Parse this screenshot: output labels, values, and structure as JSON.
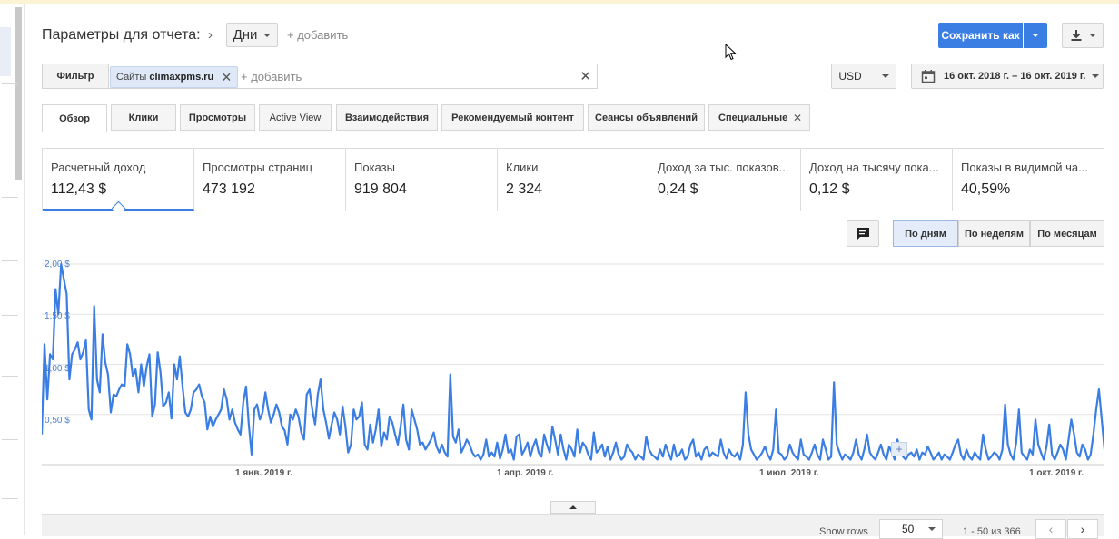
{
  "header": {
    "title": "Параметры для отчета:",
    "dimension": "Дни",
    "add_link": "+ добавить",
    "save_label": "Сохранить как"
  },
  "filter": {
    "label": "Фильтр",
    "chip_prefix": "Сайты",
    "chip_value": "climaxpms.ru",
    "add_link": "+ добавить"
  },
  "currency": "USD",
  "date_range": "16 окт. 2018 г. – 16 окт. 2019 г.",
  "tabs": [
    "Обзор",
    "Клики",
    "Просмотры",
    "Active View",
    "Взаимодействия",
    "Рекомендуемый контент",
    "Сеансы объявлений",
    "Специальные"
  ],
  "metrics": [
    {
      "label": "Расчетный доход",
      "value": "112,43 $"
    },
    {
      "label": "Просмотры страниц",
      "value": "473 192"
    },
    {
      "label": "Показы",
      "value": "919 804"
    },
    {
      "label": "Клики",
      "value": "2 324"
    },
    {
      "label": "Доход за тыс. показов...",
      "value": "0,24 $"
    },
    {
      "label": "Доход на тысячу пока...",
      "value": "0,12 $"
    },
    {
      "label": "Показы в видимой ча...",
      "value": "40,59%"
    }
  ],
  "granularity": [
    "По дням",
    "По неделям",
    "По месяцам"
  ],
  "chart_data": {
    "type": "line",
    "series": [
      {
        "values": [
          0.3,
          1.2,
          0.65,
          1.1,
          1.05,
          1.75,
          1.5,
          2.0,
          1.85,
          1.7,
          0.85,
          1.1,
          1.15,
          1.22,
          1.05,
          1.12,
          1.24,
          0.55,
          0.45,
          1.58,
          0.85,
          0.72,
          1.3,
          1.02,
          0.9,
          0.52,
          0.7,
          0.68,
          0.75,
          0.8,
          0.78,
          1.2,
          1.1,
          0.88,
          0.95,
          0.72,
          1.0,
          0.78,
          0.98,
          1.1,
          0.48,
          0.6,
          1.12,
          0.92,
          0.58,
          0.62,
          0.72,
          0.46,
          1.0,
          0.85,
          1.08,
          0.78,
          0.52,
          0.48,
          0.55,
          0.72,
          0.75,
          0.8,
          0.68,
          0.62,
          0.35,
          0.48,
          0.38,
          0.45,
          0.5,
          0.55,
          0.75,
          0.65,
          0.45,
          0.55,
          0.42,
          0.35,
          0.3,
          0.62,
          0.78,
          0.4,
          0.1,
          0.55,
          0.6,
          0.45,
          0.52,
          0.72,
          0.55,
          0.42,
          0.5,
          0.6,
          0.52,
          0.38,
          0.34,
          0.2,
          0.5,
          0.45,
          0.55,
          0.48,
          0.32,
          0.25,
          0.7,
          0.75,
          0.55,
          0.4,
          0.7,
          0.85,
          0.55,
          0.42,
          0.26,
          0.4,
          0.52,
          0.45,
          0.3,
          0.58,
          0.38,
          0.12,
          0.2,
          0.55,
          0.45,
          0.48,
          0.62,
          0.2,
          0.15,
          0.4,
          0.22,
          0.35,
          0.55,
          0.18,
          0.32,
          0.25,
          0.48,
          0.42,
          0.3,
          0.2,
          0.38,
          0.6,
          0.25,
          0.15,
          0.55,
          0.45,
          0.35,
          0.2,
          0.22,
          0.15,
          0.2,
          0.25,
          0.32,
          0.18,
          0.12,
          0.2,
          0.12,
          0.08,
          0.9,
          0.28,
          0.22,
          0.35,
          0.12,
          0.18,
          0.25,
          0.2,
          0.12,
          0.08,
          0.1,
          0.05,
          0.1,
          0.25,
          0.08,
          0.12,
          0.08,
          0.22,
          0.06,
          0.15,
          0.3,
          0.12,
          0.15,
          0.05,
          0.28,
          0.3,
          0.1,
          0.15,
          0.22,
          0.08,
          0.18,
          0.25,
          0.12,
          0.08,
          0.3,
          0.2,
          0.12,
          0.38,
          0.25,
          0.1,
          0.3,
          0.15,
          0.05,
          0.2,
          0.15,
          0.08,
          0.35,
          0.12,
          0.22,
          0.18,
          0.1,
          0.05,
          0.32,
          0.12,
          0.15,
          0.2,
          0.08,
          0.18,
          0.05,
          0.12,
          0.22,
          0.1,
          0.05,
          0.08,
          0.2,
          0.15,
          0.12,
          0.05,
          0.1,
          0.08,
          0.05,
          0.28,
          0.15,
          0.1,
          0.08,
          0.05,
          0.15,
          0.08,
          0.2,
          0.12,
          0.05,
          0.2,
          0.08,
          0.1,
          0.15,
          0.05,
          0.08,
          0.2,
          0.25,
          0.08,
          0.12,
          0.05,
          0.15,
          0.18,
          0.08,
          0.12,
          0.1,
          0.08,
          0.25,
          0.12,
          0.06,
          0.15,
          0.1,
          0.08,
          0.12,
          0.05,
          0.2,
          0.72,
          0.3,
          0.15,
          0.1,
          0.05,
          0.08,
          0.12,
          0.18,
          0.1,
          0.05,
          0.15,
          0.55,
          0.12,
          0.1,
          0.05,
          0.08,
          0.2,
          0.12,
          0.08,
          0.05,
          0.25,
          0.1,
          0.08,
          0.05,
          0.12,
          0.2,
          0.1,
          0.05,
          0.25,
          0.15,
          0.05,
          0.08,
          0.82,
          0.2,
          0.12,
          0.05,
          0.1,
          0.08,
          0.05,
          0.12,
          0.25,
          0.1,
          0.05,
          0.15,
          0.3,
          0.12,
          0.08,
          0.05,
          0.12,
          0.2,
          0.1,
          0.05,
          0.18,
          0.12,
          0.05,
          0.25,
          0.15,
          0.08,
          0.05,
          0.1,
          0.12,
          0.08,
          0.15,
          0.05,
          0.12,
          0.1,
          0.18,
          0.12,
          0.05,
          0.08,
          0.12,
          0.05,
          0.1,
          0.08,
          0.05,
          0.12,
          0.2,
          0.25,
          0.1,
          0.05,
          0.15,
          0.08,
          0.05,
          0.12,
          0.08,
          0.05,
          0.3,
          0.15,
          0.05,
          0.08,
          0.12,
          0.1,
          0.05,
          0.15,
          0.6,
          0.2,
          0.1,
          0.05,
          0.22,
          0.55,
          0.12,
          0.08,
          0.05,
          0.15,
          0.1,
          0.45,
          0.2,
          0.12,
          0.05,
          0.18,
          0.4,
          0.1,
          0.05,
          0.12,
          0.2,
          0.15,
          0.05,
          0.25,
          0.45,
          0.3,
          0.12,
          0.08,
          0.2,
          0.15,
          0.05,
          0.1,
          0.3,
          0.55,
          0.75,
          0.45,
          0.15
        ]
      }
    ],
    "xlabels": [
      "1 янв. 2019 г.",
      "1 апр. 2019 г.",
      "1 июл. 2019 г.",
      "1 окт. 2019 г."
    ],
    "ylabels": [
      "0,50 $",
      "1,00 $",
      "1,50 $",
      "2,00 $"
    ],
    "ylim": [
      0,
      2.0
    ],
    "grid": true,
    "color": "#3a7ee4"
  },
  "table_controls": {
    "show_rows_label": "Show rows",
    "rows_value": "50",
    "range_text": "1 - 50 из 366"
  }
}
